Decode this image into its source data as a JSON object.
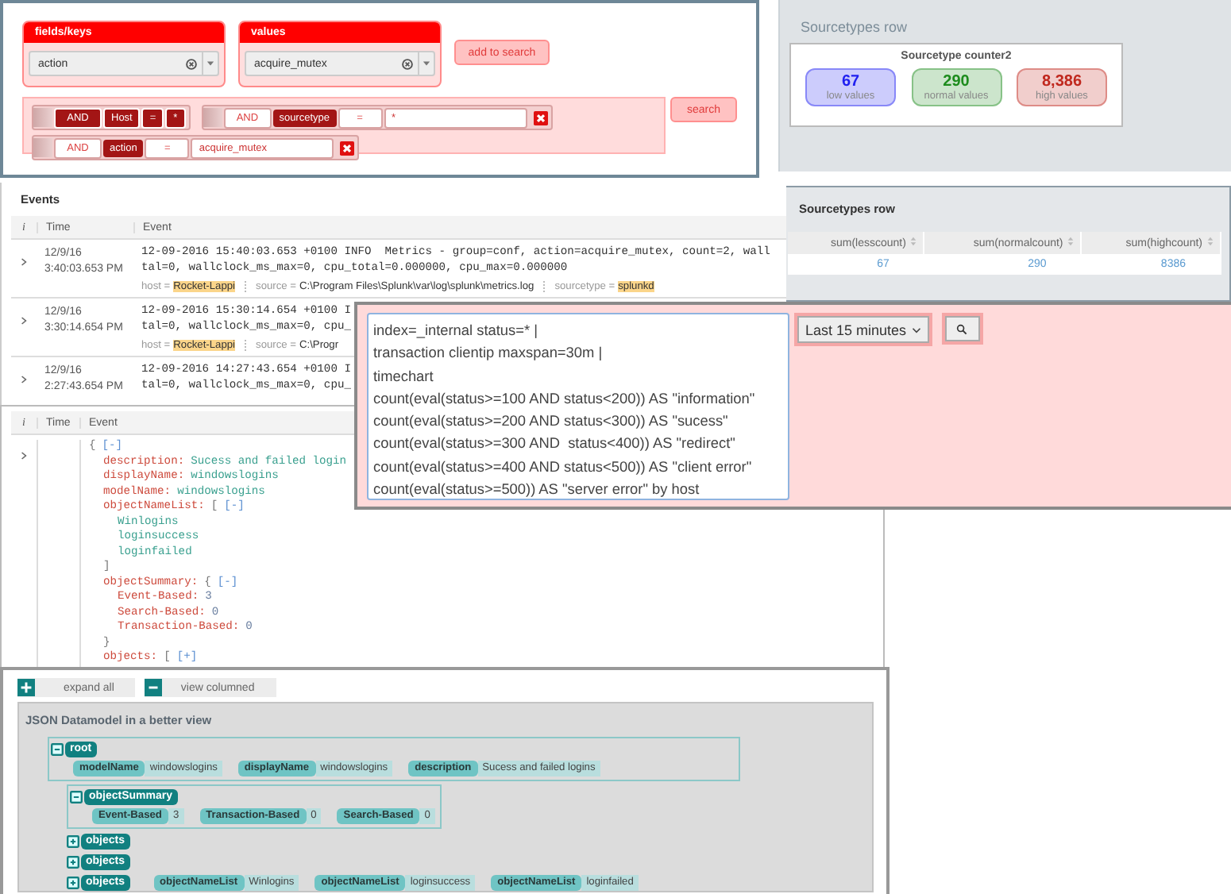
{
  "search_builder": {
    "pickers": [
      {
        "title": "fields/keys",
        "value": "action"
      },
      {
        "title": "values",
        "value": "acquire_mutex"
      }
    ],
    "add_button": "add to search",
    "clause_rows": [
      {
        "clauses": [
          {
            "kind": "compact",
            "op": "AND",
            "field": "Host",
            "cmp": "=",
            "value": "*"
          },
          {
            "kind": "removable",
            "op": "AND",
            "field": "sourcetype",
            "cmp": "=",
            "value": "*"
          }
        ]
      },
      {
        "clauses": [
          {
            "kind": "removable",
            "op": "AND",
            "field": "action",
            "cmp": "=",
            "value": "acquire_mutex"
          }
        ]
      }
    ],
    "search_button": "search"
  },
  "counter_row": {
    "title": "Sourcetypes row",
    "card_title": "Sourcetype counter2",
    "tiles": [
      {
        "value": "67",
        "label": "low values",
        "color": "#2020f0"
      },
      {
        "value": "290",
        "label": "normal values",
        "color": "#1e8c1e"
      },
      {
        "value": "8,386",
        "label": "high values",
        "color": "#c0281e"
      }
    ]
  },
  "sourcetypes_table": {
    "title": "Sourcetypes row",
    "columns": [
      "sum(lesscount)",
      "sum(normalcount)",
      "sum(highcount)"
    ],
    "rows": [
      [
        "67",
        "290",
        "8386"
      ]
    ]
  },
  "events": {
    "title": "Events",
    "columns": [
      "i",
      "Time",
      "Event"
    ],
    "rows": [
      {
        "date": "12/9/16",
        "time": "3:40:03.653 PM",
        "lines": [
          "12-09-2016 15:40:03.653 +0100 INFO  Metrics - group=conf, action=acquire_mutex, count=2, wall",
          "tal=0, wallclock_ms_max=0, cpu_total=0.000000, cpu_max=0.000000"
        ],
        "meta": [
          {
            "key": "host =",
            "value": "Rocket-Lappi",
            "highlight": true
          },
          {
            "key": "source =",
            "value": "C:\\Program Files\\Splunk\\var\\log\\splunk\\metrics.log",
            "highlight": false
          },
          {
            "key": "sourcetype =",
            "value": "splunkd",
            "highlight": true
          }
        ]
      },
      {
        "date": "12/9/16",
        "time": "3:30:14.654 PM",
        "lines": [
          "12-09-2016 15:30:14.654 +0100 I",
          "tal=0, wallclock_ms_max=0, cpu_"
        ],
        "meta": [
          {
            "key": "host =",
            "value": "Rocket-Lappi",
            "highlight": true
          },
          {
            "key": "source =",
            "value": "C:\\Progr",
            "highlight": false
          }
        ]
      },
      {
        "date": "12/9/16",
        "time": "2:27:43.654 PM",
        "lines": [
          "12-09-2016 14:27:43.654 +0100 I",
          "tal=0, wallclock_ms_max=0, cpu_"
        ],
        "meta": []
      }
    ]
  },
  "query_panel": {
    "query": "index=_internal status=* |\ntransaction clientip maxspan=30m |\ntimechart\ncount(eval(status>=100 AND status<200)) AS \"information\"\ncount(eval(status>=200 AND status<300)) AS \"sucess\"\ncount(eval(status>=300 AND  status<400)) AS \"redirect\"\ncount(eval(status>=400 AND status<500)) AS \"client error\"\ncount(eval(status>=500)) AS \"server error\" by host",
    "time_range": "Last 15 minutes"
  },
  "json_event": {
    "columns": [
      "i",
      "Time",
      "Event"
    ],
    "tree": {
      "open": "{",
      "toggle": "[-]",
      "children": [
        {
          "key": "description:",
          "value": "Sucess and failed login",
          "kind": "string"
        },
        {
          "key": "displayName:",
          "value": "windowslogins",
          "kind": "string"
        },
        {
          "key": "modelName:",
          "value": "windowslogins",
          "kind": "string"
        },
        {
          "key": "objectNameList:",
          "open": "[",
          "toggle": "[-]",
          "close": "]",
          "children": [
            {
              "value": "Winlogins",
              "kind": "string"
            },
            {
              "value": "loginsuccess",
              "kind": "string"
            },
            {
              "value": "loginfailed",
              "kind": "string"
            }
          ]
        },
        {
          "key": "objectSummary:",
          "open": "{",
          "toggle": "[-]",
          "close": "}",
          "children": [
            {
              "key": "Event-Based:",
              "value": "3",
              "kind": "number"
            },
            {
              "key": "Search-Based:",
              "value": "0",
              "kind": "number"
            },
            {
              "key": "Transaction-Based:",
              "value": "0",
              "kind": "number"
            }
          ]
        },
        {
          "key": "objects:",
          "open": "[",
          "toggle": "[+]"
        }
      ]
    }
  },
  "datamodel": {
    "buttons": [
      {
        "label": "expand all",
        "kind": "plus"
      },
      {
        "label": "view columned",
        "kind": "minus"
      }
    ],
    "title": "JSON Datamodel in a better view",
    "root": {
      "name": "root",
      "expanded": true,
      "pairs": [
        {
          "key": "modelName",
          "value": "windowslogins"
        },
        {
          "key": "displayName",
          "value": "windowslogins"
        },
        {
          "key": "description",
          "value": "Sucess and failed logins"
        }
      ],
      "children": [
        {
          "name": "objectSummary",
          "expanded": true,
          "pairs": [
            {
              "key": "Event-Based",
              "value": "3"
            },
            {
              "key": "Transaction-Based",
              "value": "0"
            },
            {
              "key": "Search-Based",
              "value": "0"
            }
          ]
        },
        {
          "name": "objects",
          "expanded": false
        },
        {
          "name": "objects",
          "expanded": false
        },
        {
          "name": "objects",
          "expanded": false,
          "pairs": [
            {
              "key": "objectNameList",
              "value": "Winlogins"
            },
            {
              "key": "objectNameList",
              "value": "loginsuccess"
            },
            {
              "key": "objectNameList",
              "value": "loginfailed"
            }
          ]
        }
      ]
    }
  }
}
